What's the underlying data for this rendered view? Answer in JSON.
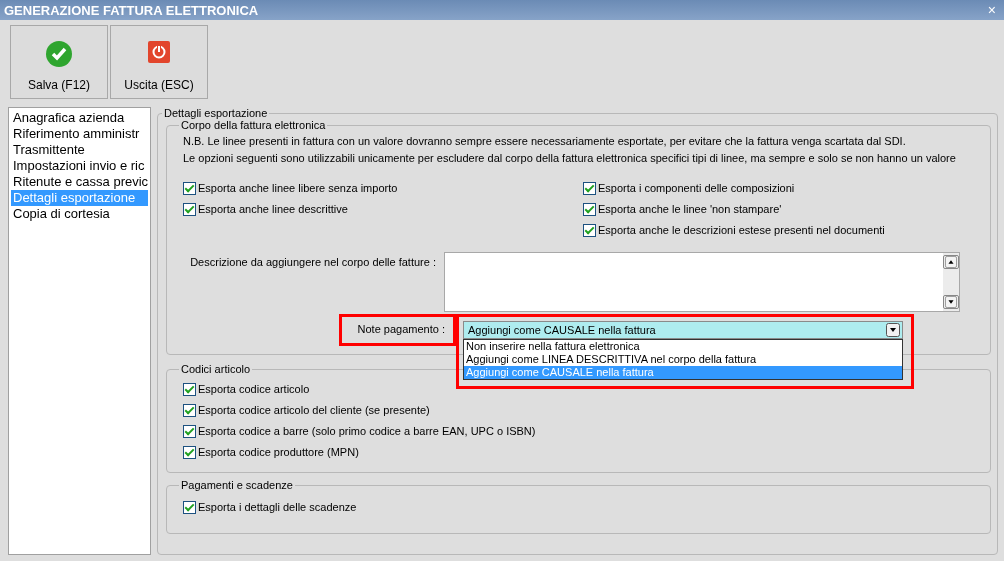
{
  "window": {
    "title": "GENERAZIONE FATTURA ELETTRONICA",
    "close": "×"
  },
  "toolbar": [
    {
      "label": "Salva (F12)",
      "kind": "save"
    },
    {
      "label": "Uscita (ESC)",
      "kind": "exit"
    }
  ],
  "sidebar": {
    "items": [
      {
        "label": "Anagrafica azienda",
        "selected": false
      },
      {
        "label": "Riferimento amministr",
        "selected": false
      },
      {
        "label": "Trasmittente",
        "selected": false
      },
      {
        "label": "Impostazioni invio e ric",
        "selected": false
      },
      {
        "label": "Ritenute e cassa previc",
        "selected": false
      },
      {
        "label": "Dettagli esportazione",
        "selected": true
      },
      {
        "label": "Copia di cortesia",
        "selected": false
      }
    ]
  },
  "details": {
    "title": "Dettagli esportazione",
    "body": {
      "title": "Corpo della fattura elettronica",
      "notes": [
        "N.B. Le linee presenti in fattura con un valore dovranno sempre essere necessariamente esportate, per evitare che la fattura venga scartata dal SDI.",
        "Le opzioni seguenti sono utilizzabili unicamente per escludere dal corpo della fattura elettronica specifici tipi di linee, ma sempre e solo se non hanno un valore"
      ],
      "options_left": [
        {
          "label": "Esporta anche linee libere senza importo",
          "checked": true
        },
        {
          "label": "Esporta anche linee descrittive",
          "checked": true
        }
      ],
      "options_right": [
        {
          "label": "Esporta i componenti delle composizioni",
          "checked": true
        },
        {
          "label": "Esporta anche le linee 'non stampare'",
          "checked": true
        },
        {
          "label": "Esporta anche le descrizioni estese presenti nel documenti",
          "checked": true
        }
      ],
      "description_label": "Descrizione da aggiungere nel corpo delle fatture :",
      "payment_label": "Note pagamento :",
      "expanded": true,
      "payment_value": "Aggiungi come CAUSALE nella fattura",
      "payment_options": [
        {
          "label": "Non inserire nella fattura elettronica",
          "selected": false
        },
        {
          "label": "Aggiungi come LINEA DESCRITTIVA nel corpo della fattura",
          "selected": false
        },
        {
          "label": "Aggiungi come CAUSALE nella fattura",
          "selected": true
        }
      ]
    },
    "article_codes": {
      "title": "Codici articolo",
      "options": [
        {
          "label": "Esporta codice articolo",
          "checked": true
        },
        {
          "label": "Esporta codice articolo del cliente (se presente)",
          "checked": true
        },
        {
          "label": "Esporta codice a barre (solo primo codice a barre EAN, UPC o ISBN)",
          "checked": true
        },
        {
          "label": "Esporta codice produttore (MPN)",
          "checked": true
        }
      ]
    },
    "payments": {
      "title": "Pagamenti e scadenze",
      "options": [
        {
          "label": "Esporta i dettagli delle scadenze",
          "checked": true
        }
      ]
    }
  }
}
